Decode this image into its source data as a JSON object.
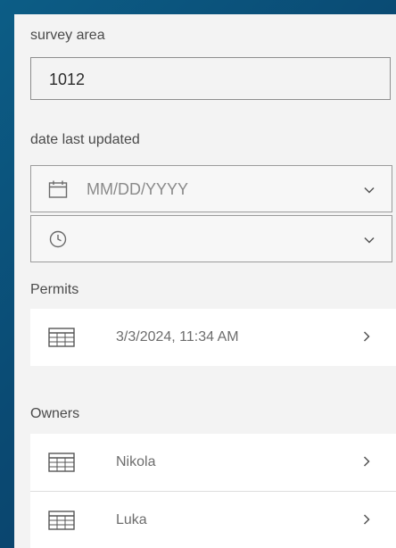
{
  "survey_area": {
    "label": "survey area",
    "value": "1012"
  },
  "date_last_updated": {
    "label": "date last updated",
    "date_placeholder": "MM/DD/YYYY",
    "date_icon": "calendar-icon",
    "time_icon": "clock-icon"
  },
  "permits": {
    "label": "Permits",
    "items": [
      {
        "text": "3/3/2024, 11:34 AM",
        "icon": "table-icon"
      }
    ]
  },
  "owners": {
    "label": "Owners",
    "items": [
      {
        "text": "Nikola",
        "icon": "table-icon"
      },
      {
        "text": "Luka",
        "icon": "table-icon"
      }
    ]
  },
  "colors": {
    "background_gradient_start": "#0c5d86",
    "background_gradient_end": "#0c3a63",
    "panel": "#f3f3f3",
    "row": "#ffffff"
  }
}
